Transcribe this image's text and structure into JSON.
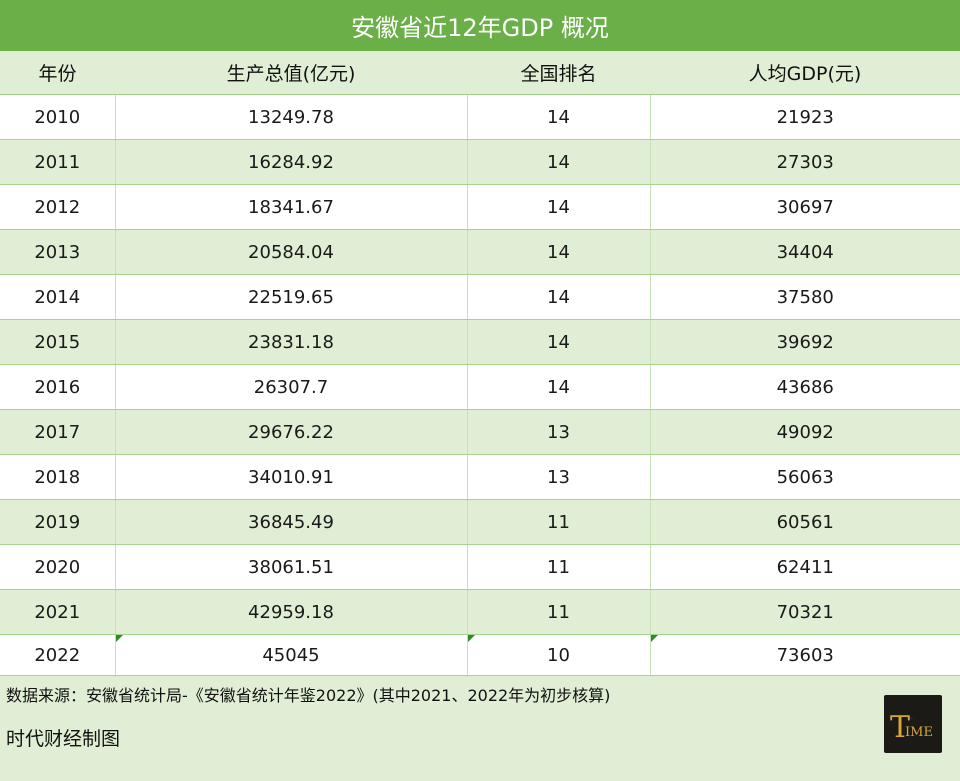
{
  "title": "安徽省近12年GDP 概况",
  "table": {
    "headers": [
      "年份",
      "生产总值(亿元)",
      "全国排名",
      "人均GDP(元)"
    ],
    "rows": [
      [
        "2010",
        "13249.78",
        "14",
        "21923"
      ],
      [
        "2011",
        "16284.92",
        "14",
        "27303"
      ],
      [
        "2012",
        "18341.67",
        "14",
        "30697"
      ],
      [
        "2013",
        "20584.04",
        "14",
        "34404"
      ],
      [
        "2014",
        "22519.65",
        "14",
        "37580"
      ],
      [
        "2015",
        "23831.18",
        "14",
        "39692"
      ],
      [
        "2016",
        "26307.7",
        "14",
        "43686"
      ],
      [
        "2017",
        "29676.22",
        "13",
        "49092"
      ],
      [
        "2018",
        "34010.91",
        "13",
        "56063"
      ],
      [
        "2019",
        "36845.49",
        "11",
        "60561"
      ],
      [
        "2020",
        "38061.51",
        "11",
        "62411"
      ],
      [
        "2021",
        "42959.18",
        "11",
        "70321"
      ],
      [
        "2022",
        "45045",
        "10",
        "73603"
      ]
    ]
  },
  "footer": {
    "source": "数据来源：安徽省统计局-《安徽省统计年鉴2022》(其中2021、2022年为初步核算)",
    "credit": "时代财经制图"
  },
  "logo": {
    "text": "TIME",
    "colors": {
      "background": "#1c1a16",
      "letters": "#d9a63a"
    }
  },
  "colors": {
    "title_bar": "#6aaf47",
    "header_bg": "#dfeed5",
    "stripe_bg": "#dfeed5",
    "row_bg": "#ffffff"
  }
}
